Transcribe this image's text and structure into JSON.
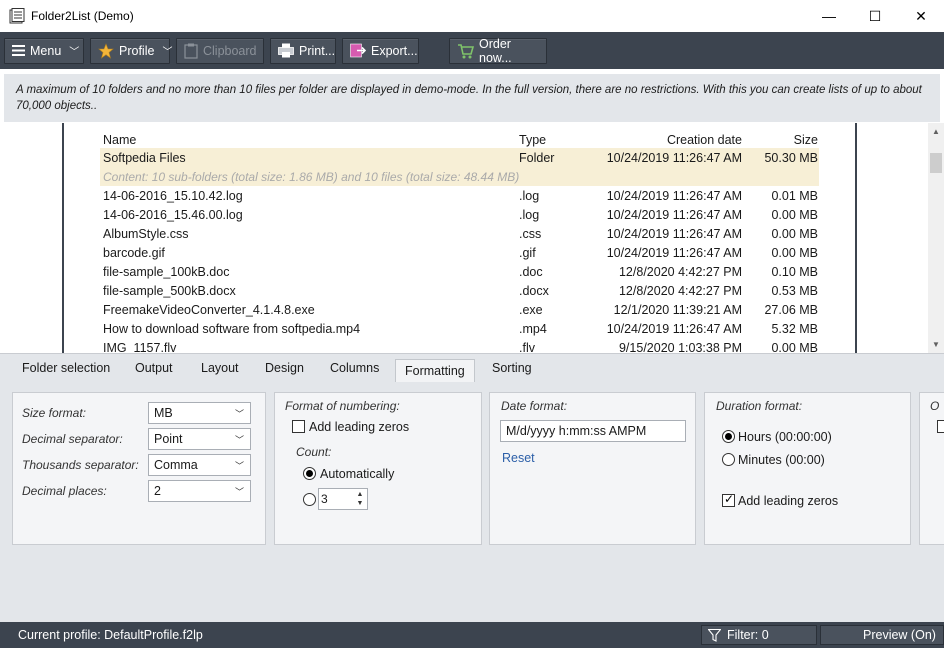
{
  "window": {
    "title": "Folder2List (Demo)",
    "minimize": "—",
    "maximize": "☐",
    "close": "✕"
  },
  "toolbar": {
    "menu": "Menu",
    "profile": "Profile",
    "clipboard": "Clipboard",
    "print": "Print...",
    "export": "Export...",
    "order": "Order now..."
  },
  "notice": "A maximum of 10 folders and no more than 10 files per folder are displayed in demo-mode. In the full version, there are no restrictions. With this you can create lists of up to about 70,000 objects..",
  "list": {
    "headers": {
      "name": "Name",
      "type": "Type",
      "date": "Creation date",
      "size": "Size"
    },
    "folder": {
      "name": "Softpedia Files",
      "type": "Folder",
      "date": "10/24/2019 11:26:47 AM",
      "size": "50.30 MB"
    },
    "content_note": "Content: 10 sub-folders (total size: 1.86 MB) and 10 files (total size: 48.44 MB)",
    "files": [
      {
        "name": "14-06-2016_15.10.42.log",
        "type": ".log",
        "date": "10/24/2019 11:26:47 AM",
        "size": "0.01 MB"
      },
      {
        "name": "14-06-2016_15.46.00.log",
        "type": ".log",
        "date": "10/24/2019 11:26:47 AM",
        "size": "0.00 MB"
      },
      {
        "name": "AlbumStyle.css",
        "type": ".css",
        "date": "10/24/2019 11:26:47 AM",
        "size": "0.00 MB"
      },
      {
        "name": "barcode.gif",
        "type": ".gif",
        "date": "10/24/2019 11:26:47 AM",
        "size": "0.00 MB"
      },
      {
        "name": "file-sample_100kB.doc",
        "type": ".doc",
        "date": "12/8/2020 4:42:27 PM",
        "size": "0.10 MB"
      },
      {
        "name": "file-sample_500kB.docx",
        "type": ".docx",
        "date": "12/8/2020 4:42:27 PM",
        "size": "0.53 MB"
      },
      {
        "name": "FreemakeVideoConverter_4.1.4.8.exe",
        "type": ".exe",
        "date": "12/1/2020 11:39:21 AM",
        "size": "27.06 MB"
      },
      {
        "name": "How to download software from softpedia.mp4",
        "type": ".mp4",
        "date": "10/24/2019 11:26:47 AM",
        "size": "5.32 MB"
      },
      {
        "name": "IMG_1157.flv",
        "type": ".flv",
        "date": "9/15/2020 1:03:38 PM",
        "size": "0.00 MB"
      }
    ]
  },
  "tabs": [
    "Folder selection",
    "Output",
    "Layout",
    "Design",
    "Columns",
    "Formatting",
    "Sorting"
  ],
  "active_tab": "Formatting",
  "formatting": {
    "size_format_label": "Size format:",
    "size_format_value": "MB",
    "decimal_sep_label": "Decimal separator:",
    "decimal_sep_value": "Point",
    "thousands_sep_label": "Thousands separator:",
    "thousands_sep_value": "Comma",
    "decimal_places_label": "Decimal places:",
    "decimal_places_value": "2",
    "numbering_label": "Format of numbering:",
    "leading_zeros": "Add leading zeros",
    "count_label": "Count:",
    "count_auto": "Automatically",
    "count_manual_value": "3",
    "date_format_label": "Date format:",
    "date_format_value": "M/d/yyyy h:mm:ss AMPM",
    "reset": "Reset",
    "duration_label": "Duration format:",
    "duration_hours": "Hours (00:00:00)",
    "duration_minutes": "Minutes (00:00)",
    "duration_leading_zeros": "Add leading zeros",
    "cut_group_label": "O"
  },
  "status": {
    "profile": "Current profile: DefaultProfile.f2lp",
    "filter": "Filter: 0",
    "preview": "Preview (On)"
  },
  "colors": {
    "toolbar_bg": "#3c444f",
    "folder_row": "#f7efd6",
    "link": "#2c5fa8"
  }
}
